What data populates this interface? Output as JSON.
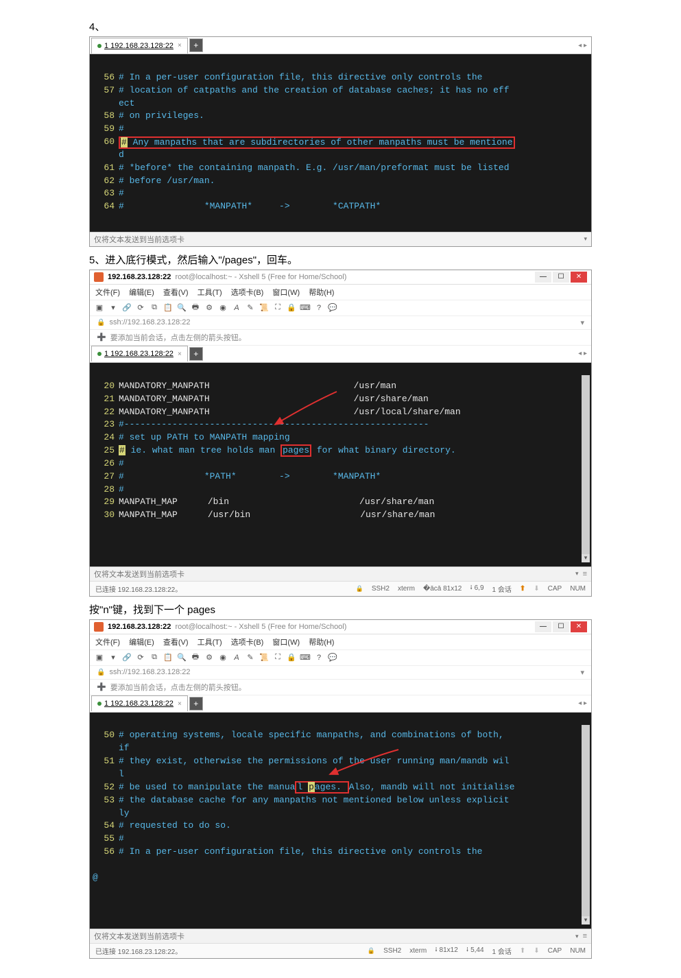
{
  "section4_label": "4、",
  "section5_label": "5、进入底行模式，然后输入\"/pages\"，回车。",
  "section_n_label": "按\"n\"键，找到下一个 pages",
  "tab_ip": "1 192.168.23.128:22",
  "plus": "+",
  "nav_arrows": "◂ ▸",
  "top_terminal": {
    "l56n": "56",
    "l56": "# In a per-user configuration file, this directive only controls the",
    "l57n": "57",
    "l57": "# location of catpaths and the creation of database caches; it has no eff",
    "l57b": "ect",
    "l58n": "58",
    "l58": "# on privileges.",
    "l59n": "59",
    "l59": "#",
    "l60n": "60",
    "l60_hash": "#",
    "l60_rest": " Any manpaths that are subdirectories of other manpaths must be mentione",
    "l60b": "d",
    "l61n": "61",
    "l61": "# *before* the containing manpath. E.g. /usr/man/preformat must be listed",
    "l62n": "62",
    "l62": "# before /usr/man.",
    "l63n": "63",
    "l63": "#",
    "l64n": "64",
    "l64": "#               *MANPATH*     ->        *CATPATH*"
  },
  "bottom_text": "仅将文本发送到当前选项卡",
  "xshell_title_ipport": "192.168.23.128:22",
  "xshell_title_rest": "root@localhost:~ - Xshell 5 (Free for Home/School)",
  "menu": {
    "file": "文件(F)",
    "edit": "编辑(E)",
    "view": "查看(V)",
    "tools": "工具(T)",
    "tab": "选项卡(B)",
    "window": "窗口(W)",
    "help": "帮助(H)"
  },
  "addr": "ssh://192.168.23.128:22",
  "hint": "要添加当前会话，点击左侧的箭头按钮。",
  "mid_terminal": {
    "l20n": "20",
    "l20a": "MANDATORY_MANPATH",
    "l20b": "/usr/man",
    "l21n": "21",
    "l21a": "MANDATORY_MANPATH",
    "l21b": "/usr/share/man",
    "l22n": "22",
    "l22a": "MANDATORY_MANPATH",
    "l22b": "/usr/local/share/man",
    "l23n": "23",
    "l23": "#---------------------------------------------------------",
    "l24n": "24",
    "l24": "# set up PATH to MANPATH mapping",
    "l25n": "25",
    "l25_hash": "#",
    "l25_a": " ie. what man tree holds man ",
    "l25_pages": "pages",
    "l25_b": " for what binary directory.",
    "l26n": "26",
    "l26": "#",
    "l27n": "27",
    "l27": "#               *PATH*        ->        *MANPATH*",
    "l28n": "28",
    "l28": "#",
    "l29n": "29",
    "l29a": "MANPATH_MAP",
    "l29b": "/bin",
    "l29c": "/usr/share/man",
    "l30n": "30",
    "l30a": "MANPATH_MAP",
    "l30b": "/usr/bin",
    "l30c": "/usr/share/man"
  },
  "status": {
    "connected": "已连接 192.168.23.128:22。",
    "ssh": "SSH2",
    "xterm": "xterm",
    "size1": "81x12",
    "pos1": "6,9",
    "pos2": "5,44",
    "sess": "1 会话",
    "cap": "CAP",
    "num": "NUM"
  },
  "bot_terminal": {
    "l50n": "50",
    "l50": "# operating systems, locale specific manpaths, and combinations of both,",
    "l50b": "if",
    "l51n": "51",
    "l51": "# they exist, otherwise the permissions of the user running man/mandb wil",
    "l51b": "l",
    "l52n": "52",
    "l52a": "# be used to manipulate the manua",
    "l52_l": "l ",
    "l52_p": "p",
    "l52b": "ages. ",
    "l52c": "Also, mandb will not initialise",
    "l53n": "53",
    "l53": "# the database cache for any manpaths not mentioned below unless explicit",
    "l53b": "ly",
    "l54n": "54",
    "l54": "# requested to do so.",
    "l55n": "55",
    "l55": "#",
    "l56n": "56",
    "l56": "# In a per-user configuration file, this directive only controls the",
    "at": "@"
  }
}
